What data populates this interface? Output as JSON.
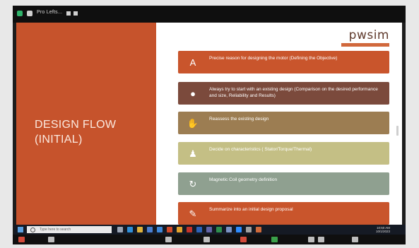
{
  "window": {
    "title": "Pro Lefts..."
  },
  "slide": {
    "heading_line1": "DESIGN FLOW",
    "heading_line2": "(INITIAL)",
    "logo_text": "pwsim",
    "steps": [
      {
        "text": "Precise reason for designing the motor (Defining the Objective)",
        "color": "#c9552c",
        "icon": "text-a-icon",
        "glyph": "A"
      },
      {
        "text": "Always try to start with an existing design (Comparison on the desired performance and size, Reliability and Results)",
        "color": "#7b4a3c",
        "icon": "gear-icon",
        "glyph": "●"
      },
      {
        "text": "Reassess the existing design",
        "color": "#9c7d52",
        "icon": "hand-icon",
        "glyph": "✋"
      },
      {
        "text": "Decide on characteristics ( Stator/Torque/Thermal)",
        "color": "#c4bf85",
        "icon": "user-icon",
        "glyph": "♟"
      },
      {
        "text": "Magnetic Coil geometry definition",
        "color": "#8fa090",
        "icon": "refresh-icon",
        "glyph": "↻"
      },
      {
        "text": "Summarize into an initial design proposal",
        "color": "#c9552c",
        "icon": "pencil-icon",
        "glyph": "✎"
      }
    ]
  },
  "taskbar": {
    "search_placeholder": "Type here to search",
    "time": "10:50 AM",
    "date": "10/1/2023"
  }
}
